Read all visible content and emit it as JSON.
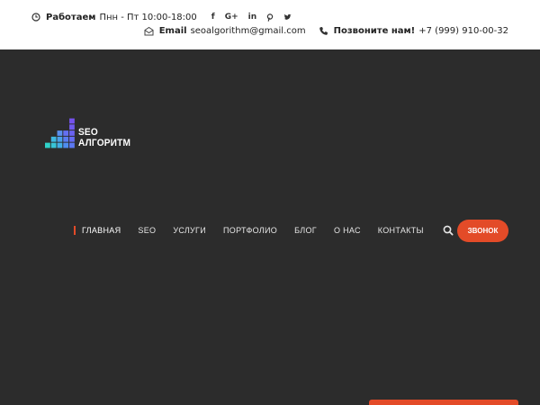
{
  "topbar": {
    "hours_label": "Работаем",
    "hours_value": "Пнн - Пт 10:00-18:00",
    "socials": [
      "f",
      "G+",
      "in",
      "pinterest",
      "twitter"
    ],
    "email_label": "Email",
    "email_value": "seoalgorithm@gmail.com",
    "phone_label": "Позвоните нам!",
    "phone_value": "+7 (999) 910-00-32"
  },
  "logo": {
    "line1": "SEO",
    "line2": "АЛГОРИТМ"
  },
  "nav": {
    "items": [
      "ГЛАВНАЯ",
      "SEO",
      "УСЛУГИ",
      "ПОРТФОЛИО",
      "БЛОГ",
      "О НАС",
      "КОНТАКТЫ"
    ],
    "call_button": "ЗВОНОК"
  },
  "colors": {
    "accent": "#e34b28",
    "header_bg": "#2c2c2c",
    "topbar_bg": "#ffffff"
  }
}
